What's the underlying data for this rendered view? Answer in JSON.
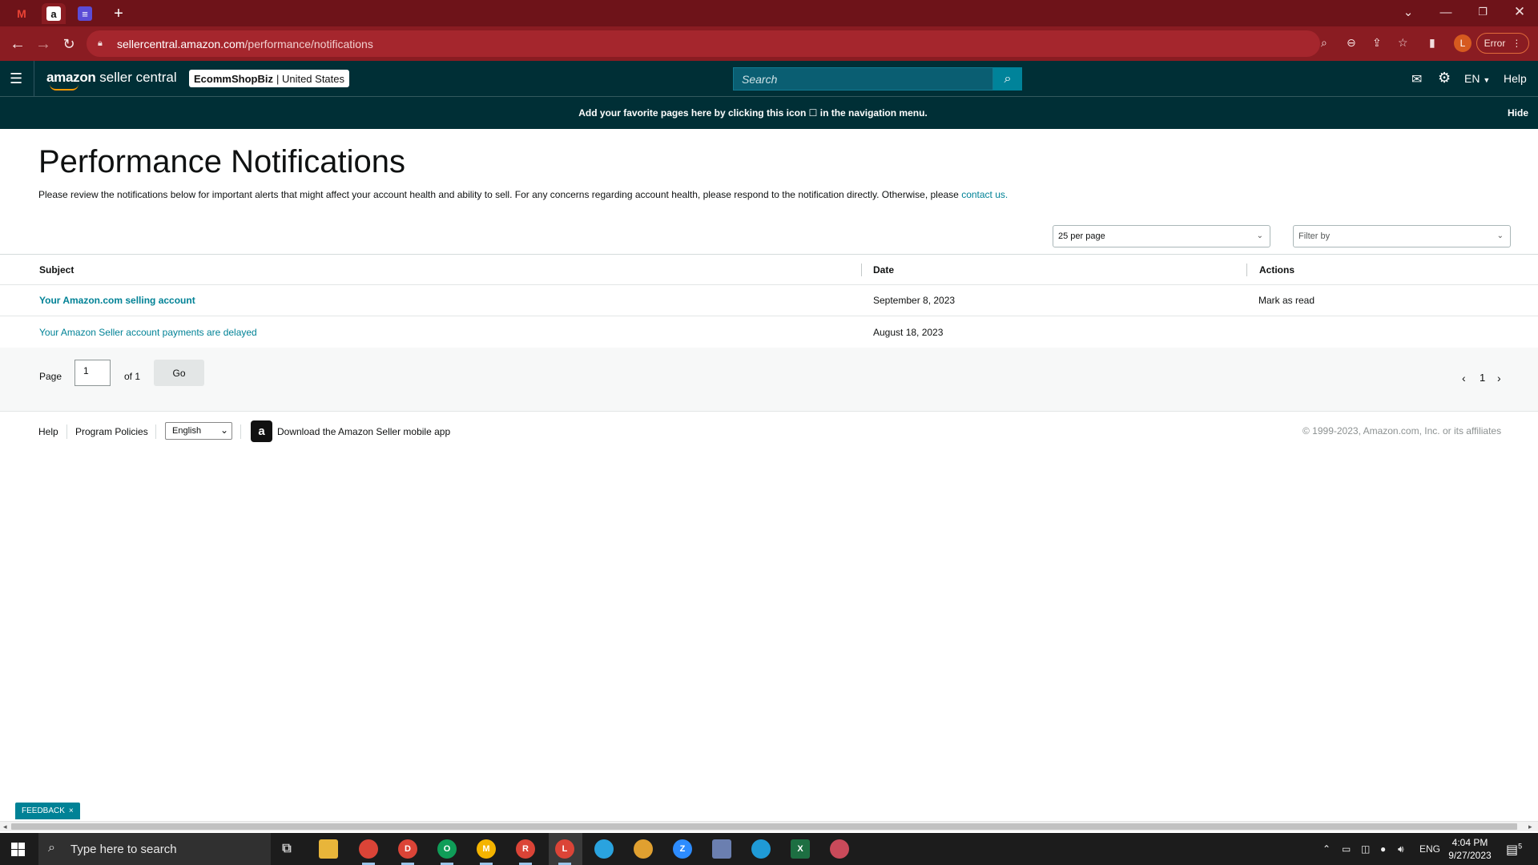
{
  "browser": {
    "tabs": [
      {
        "icon": "gmail-icon",
        "glyph": "M",
        "color": "#ea4335"
      },
      {
        "icon": "amazon-icon",
        "glyph": "a",
        "color": "#111111"
      },
      {
        "icon": "docs-list-icon",
        "glyph": "≡",
        "color": "#5b4cd6"
      }
    ],
    "new_tab_glyph": "+",
    "url_host": "sellercentral.amazon.com",
    "url_path": "/performance/notifications",
    "profile_initial": "L",
    "error_label": "Error"
  },
  "header": {
    "logo_brand": "amazon",
    "logo_product": "seller central",
    "store_name": "EcommShopBiz",
    "store_region": "| United States",
    "search_placeholder": "Search",
    "language": "EN",
    "help": "Help"
  },
  "banner": {
    "message": "Add your favorite pages here by clicking this icon ☐ in the navigation menu.",
    "hide": "Hide"
  },
  "page": {
    "title": "Performance Notifications",
    "intro_text": "Please review the notifications below for important alerts that might affect your account health and ability to sell. For any concerns regarding account health, please respond to the notification directly. Otherwise, please ",
    "intro_link": "contact us.",
    "per_page": "25 per page",
    "filter_placeholder": "Filter by"
  },
  "table": {
    "columns": [
      "Subject",
      "Date",
      "Actions"
    ],
    "rows": [
      {
        "subject": "Your Amazon.com selling account",
        "date": "September 8, 2023",
        "action": "Mark as read",
        "unread": true
      },
      {
        "subject": "Your Amazon Seller account payments are delayed",
        "date": "August 18, 2023",
        "action": "",
        "unread": false
      }
    ]
  },
  "pagination": {
    "page_label": "Page",
    "page_value": "1",
    "of_label": "of 1",
    "go": "Go",
    "current_page": "1"
  },
  "footer": {
    "help": "Help",
    "program_policies": "Program Policies",
    "language": "English",
    "app_text": "Download the Amazon Seller mobile app",
    "copyright": "© 1999-2023, Amazon.com, Inc. or its affiliates"
  },
  "feedback": {
    "label": "FEEDBACK",
    "close": "×"
  },
  "taskbar": {
    "search_placeholder": "Type here to search",
    "language": "ENG",
    "time": "4:04 PM",
    "date": "9/27/2023",
    "notification_count": "5",
    "apps": [
      {
        "name": "chrome-icon",
        "badge": "",
        "color": "#db4437"
      },
      {
        "name": "chrome-profile-d-icon",
        "badge": "D",
        "color": "#db4437"
      },
      {
        "name": "chrome-profile-o-icon",
        "badge": "O",
        "color": "#0f9d58"
      },
      {
        "name": "chrome-profile-m-icon",
        "badge": "M",
        "color": "#f4b400"
      },
      {
        "name": "chrome-profile-r-icon",
        "badge": "R",
        "color": "#db4437"
      },
      {
        "name": "chrome-profile-l-icon",
        "badge": "L",
        "color": "#db4437"
      },
      {
        "name": "telegram-icon",
        "badge": "",
        "color": "#2aa3df"
      },
      {
        "name": "app-character-icon",
        "badge": "",
        "color": "#e0a030"
      },
      {
        "name": "zoom-icon",
        "badge": "Z",
        "color": "#2d8cff"
      },
      {
        "name": "calculator-icon",
        "badge": "",
        "color": "#6b7fb0"
      },
      {
        "name": "edge-icon",
        "badge": "",
        "color": "#1f9ad6"
      },
      {
        "name": "excel-icon",
        "badge": "X",
        "color": "#1d6f42"
      },
      {
        "name": "snipping-tool-icon",
        "badge": "",
        "color": "#c94a5a"
      }
    ]
  },
  "colors": {
    "browser_frame": "#6e1319",
    "header_bg": "#002f36",
    "accent_link": "#008296",
    "search_btn": "#00839a"
  }
}
